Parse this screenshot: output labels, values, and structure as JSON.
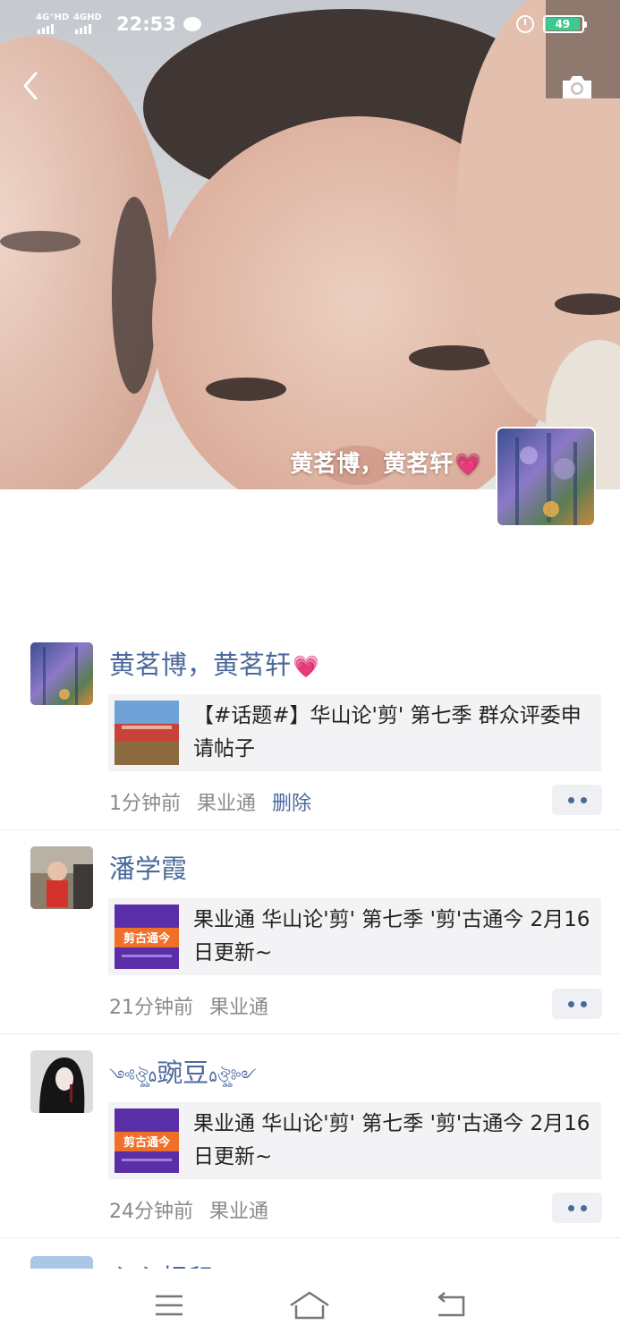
{
  "status_bar": {
    "network_1": "4G⁺HD",
    "network_2": "4GHD",
    "time": "22:53",
    "battery": "49",
    "icons": [
      "signal-icon",
      "message-icon",
      "alarm-icon",
      "battery-icon"
    ]
  },
  "header": {
    "back_icon": "back-chevron-icon",
    "camera_icon": "camera-icon"
  },
  "profile": {
    "name": "黄茗博，黄茗轩",
    "name_emoji": "💗"
  },
  "posts": [
    {
      "author": "黄茗博，黄茗轩",
      "author_emoji": "💗",
      "link_title": "【#话题#】华山论'剪' 第七季 群众评委申请帖子",
      "time": "1分钟前",
      "source": "果业通",
      "action": "删除"
    },
    {
      "author": "潘学霞",
      "link_title": "果业通 华山论'剪' 第七季 '剪'古通今 2月16日更新~",
      "time": "21分钟前",
      "source": "果业通"
    },
    {
      "author": "豌豆",
      "author_deco_left": "༺ঔৣ۵",
      "author_deco_right": "۵ঔৣ༻",
      "link_title": "果业通 华山论'剪' 第七季 '剪'古通今 2月16日更新~",
      "time": "24分钟前",
      "source": "果业通"
    },
    {
      "author": "心心相印"
    }
  ],
  "thumbnails": {
    "poster_text": "剪古通今"
  },
  "nav_bar": {
    "icons": [
      "menu-icon",
      "home-icon",
      "back-icon"
    ]
  },
  "colors": {
    "accent_name": "#4b6a9b",
    "meta": "#8a8a8a",
    "card_bg": "#f3f3f5",
    "heart": "#ff5aa6",
    "battery": "#3ec98f"
  }
}
